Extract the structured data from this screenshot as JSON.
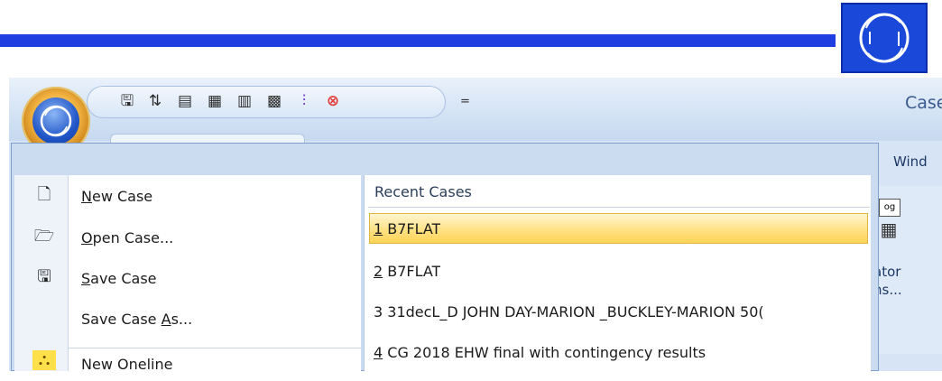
{
  "window": {
    "title": "Case"
  },
  "tabs": {
    "partial": "Wind"
  },
  "quick_access": {
    "icons": [
      "save-case-icon",
      "auto-save-icon",
      "database-icon",
      "document-icon",
      "calculator-icon",
      "case-info-icon",
      "transformer-icon",
      "close-circle-icon"
    ],
    "dropdown_glyph": "="
  },
  "ribbon": {
    "partial_label_line1": "ator",
    "partial_label_line2": "ns..."
  },
  "menu": {
    "items": [
      {
        "label": "New Case",
        "accel": "N",
        "rest": "ew Case",
        "icon": "new-case-icon"
      },
      {
        "label": "Open Case...",
        "accel": "O",
        "rest": "pen Case...",
        "icon": "open-case-icon"
      },
      {
        "label": "Save Case",
        "accel": "S",
        "rest": "ave Case",
        "icon": "save-case-icon"
      },
      {
        "label": "Save Case As...",
        "before": "Save Case ",
        "accel": "A",
        "rest": "s...",
        "icon": ""
      },
      {
        "label": "New Oneline",
        "accel": "",
        "rest": "New Oneline",
        "icon": "new-oneline-icon"
      }
    ],
    "recent_header": "Recent Cases",
    "recent": [
      {
        "num": "1",
        "text": " B7FLAT"
      },
      {
        "num": "2",
        "text": " B7FLAT"
      },
      {
        "num": "3",
        "text": " 31decL_D JOHN DAY-MARION _BUCKLEY-MARION 50("
      },
      {
        "num": "4",
        "text": " CG 2018 EHW final with contingency results"
      }
    ]
  },
  "colors": {
    "banner_blue": "#1f3fe0",
    "highlight": "#ffe285",
    "menu_border": "#7fa0cc"
  }
}
